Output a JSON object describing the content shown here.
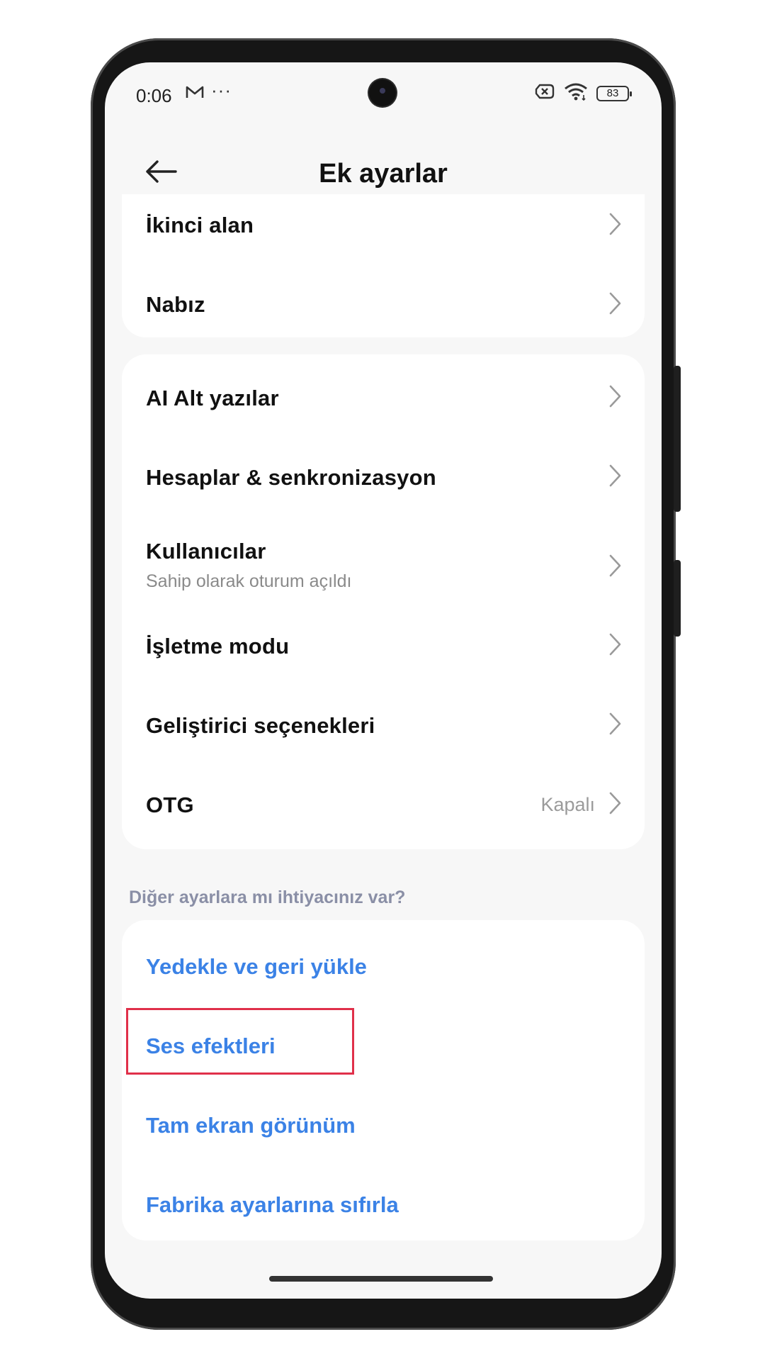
{
  "status_bar": {
    "time": "0:06",
    "battery": "83",
    "icons": [
      "mail-icon",
      "more-dots-icon",
      "camera-punch-hole",
      "sim-off-icon",
      "wifi-icon",
      "battery-icon"
    ]
  },
  "header": {
    "title": "Ek ayarlar",
    "back_icon": "arrow-left-icon"
  },
  "group1": [
    {
      "label": "İkinci alan"
    },
    {
      "label": "Nabız"
    }
  ],
  "group2": [
    {
      "label": "AI Alt yazılar"
    },
    {
      "label": "Hesaplar & senkronizasyon"
    },
    {
      "label": "Kullanıcılar",
      "sub": "Sahip olarak oturum açıldı"
    },
    {
      "label": "İşletme modu"
    },
    {
      "label": "Geliştirici seçenekleri"
    },
    {
      "label": "OTG",
      "value": "Kapalı"
    }
  ],
  "hint": "Diğer ayarlara mı ihtiyacınız var?",
  "links": [
    {
      "label": "Yedekle ve geri yükle"
    },
    {
      "label": "Ses efektleri"
    },
    {
      "label": "Tam ekran görünüm"
    },
    {
      "label": "Fabrika ayarlarına sıfırla"
    }
  ],
  "colors": {
    "link": "#3b82e6",
    "highlight": "#e0304a",
    "background": "#f7f7f7"
  }
}
